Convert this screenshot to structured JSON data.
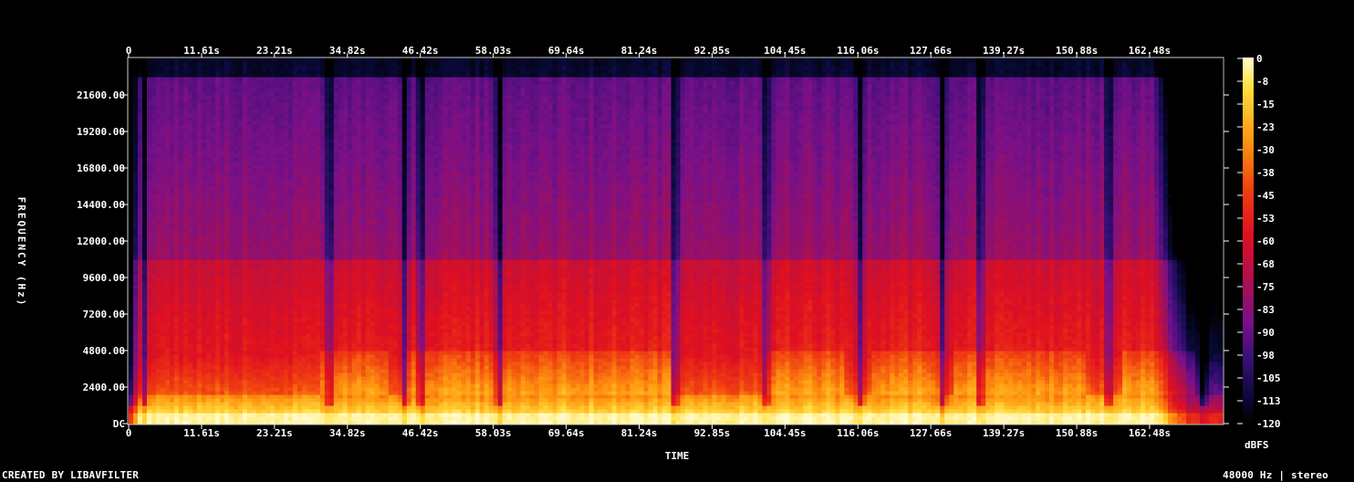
{
  "footer": {
    "credit": "CREATED BY LIBAVFILTER",
    "format": "48000 Hz | stereo"
  },
  "chart_data": {
    "type": "heatmap",
    "xlabel": "TIME",
    "ylabel": "FREQUENCY (Hz)",
    "colorbar_label": "dBFS",
    "x_ticks": [
      "0",
      "11.61s",
      "23.21s",
      "34.82s",
      "46.42s",
      "58.03s",
      "69.64s",
      "81.24s",
      "92.85s",
      "104.45s",
      "116.06s",
      "127.66s",
      "139.27s",
      "150.88s",
      "162.48s"
    ],
    "x_tick_values": [
      0,
      11.61,
      23.21,
      34.82,
      46.42,
      58.03,
      69.64,
      81.24,
      92.85,
      104.45,
      116.06,
      127.66,
      139.27,
      150.88,
      162.48
    ],
    "xlim": [
      0,
      174.1
    ],
    "y_ticks": [
      "DC",
      "2400.00",
      "4800.00",
      "7200.00",
      "9600.00",
      "12000.00",
      "14400.00",
      "16800.00",
      "19200.00",
      "21600.00"
    ],
    "y_tick_values": [
      0,
      2400,
      4800,
      7200,
      9600,
      12000,
      14400,
      16800,
      19200,
      21600
    ],
    "ylim": [
      0,
      24000
    ],
    "colorbar_ticks": [
      "0",
      "-8",
      "-15",
      "-23",
      "-30",
      "-38",
      "-45",
      "-53",
      "-60",
      "-68",
      "-75",
      "-83",
      "-90",
      "-98",
      "-105",
      "-113",
      "-120"
    ],
    "colorbar_range_dbfs": [
      -120,
      0
    ],
    "colormap": [
      "#000000",
      "#0a0a3c",
      "#3a0f78",
      "#7a1088",
      "#b0104a",
      "#e01020",
      "#f04010",
      "#ff9a10",
      "#ffe040",
      "#fffbd0"
    ],
    "quiet_gaps_s": [
      0.5,
      2.5,
      32.0,
      44.0,
      46.5,
      59.0,
      87.0,
      101.5,
      116.5,
      129.5,
      135.5,
      156.0,
      171.0
    ],
    "dense_midband_segments_s": [
      [
        30.5,
        41.5
      ],
      [
        44,
        64.5
      ],
      [
        64.5,
        86
      ],
      [
        101.5,
        114
      ],
      [
        118,
        130
      ],
      [
        131,
        152
      ],
      [
        158,
        170
      ]
    ]
  }
}
